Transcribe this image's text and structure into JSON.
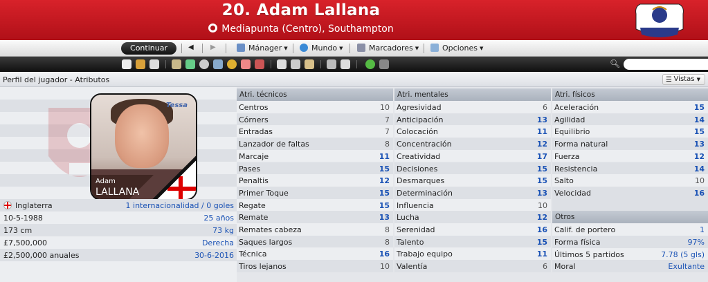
{
  "header": {
    "title": "20. Adam Lallana",
    "subtitle": "Mediapunta (Centro), Southampton"
  },
  "menubar": {
    "continue_label": "Continuar",
    "manager_label": "Mánager",
    "world_label": "Mundo",
    "bookmarks_label": "Marcadores",
    "options_label": "Opciones"
  },
  "panel": {
    "title": "Perfil del jugador - Atributos",
    "views_label": "Vistas"
  },
  "player": {
    "first_name": "Adam",
    "last_name": "LALLANA",
    "nationality": "Inglaterra",
    "caps": "1 internacionalidad / 0 goles",
    "dob": "10-5-1988",
    "age": "25 años",
    "height": "173 cm",
    "weight": "73 kg",
    "value": "£7,500,000",
    "foot": "Derecha",
    "wage": "£2,500,000 anuales",
    "contract_end": "30-6-2016"
  },
  "technical": {
    "header": "Atri. técnicos",
    "rows": [
      {
        "name": "Centros",
        "value": "10",
        "hi": false
      },
      {
        "name": "Córners",
        "value": "7",
        "hi": false
      },
      {
        "name": "Entradas",
        "value": "7",
        "hi": false
      },
      {
        "name": "Lanzador de faltas",
        "value": "8",
        "hi": false
      },
      {
        "name": "Marcaje",
        "value": "11",
        "hi": true
      },
      {
        "name": "Pases",
        "value": "15",
        "hi": true
      },
      {
        "name": "Penaltis",
        "value": "12",
        "hi": true
      },
      {
        "name": "Primer Toque",
        "value": "15",
        "hi": true
      },
      {
        "name": "Regate",
        "value": "15",
        "hi": true
      },
      {
        "name": "Remate",
        "value": "13",
        "hi": true
      },
      {
        "name": "Remates cabeza",
        "value": "8",
        "hi": false
      },
      {
        "name": "Saques largos",
        "value": "8",
        "hi": false
      },
      {
        "name": "Técnica",
        "value": "16",
        "hi": true
      },
      {
        "name": "Tiros lejanos",
        "value": "10",
        "hi": false
      }
    ]
  },
  "mental": {
    "header": "Atri. mentales",
    "rows": [
      {
        "name": "Agresividad",
        "value": "6",
        "hi": false
      },
      {
        "name": "Anticipación",
        "value": "13",
        "hi": true
      },
      {
        "name": "Colocación",
        "value": "11",
        "hi": true
      },
      {
        "name": "Concentración",
        "value": "12",
        "hi": true
      },
      {
        "name": "Creatividad",
        "value": "17",
        "hi": true
      },
      {
        "name": "Decisiones",
        "value": "15",
        "hi": true
      },
      {
        "name": "Desmarques",
        "value": "15",
        "hi": true
      },
      {
        "name": "Determinación",
        "value": "13",
        "hi": true
      },
      {
        "name": "Influencia",
        "value": "10",
        "hi": false
      },
      {
        "name": "Lucha",
        "value": "12",
        "hi": true
      },
      {
        "name": "Serenidad",
        "value": "16",
        "hi": true
      },
      {
        "name": "Talento",
        "value": "15",
        "hi": true
      },
      {
        "name": "Trabajo equipo",
        "value": "11",
        "hi": true
      },
      {
        "name": "Valentía",
        "value": "6",
        "hi": false
      }
    ]
  },
  "physical": {
    "header": "Atri. físicos",
    "rows": [
      {
        "name": "Aceleración",
        "value": "15",
        "hi": true
      },
      {
        "name": "Agilidad",
        "value": "14",
        "hi": true
      },
      {
        "name": "Equilibrio",
        "value": "15",
        "hi": true
      },
      {
        "name": "Forma natural",
        "value": "13",
        "hi": true
      },
      {
        "name": "Fuerza",
        "value": "12",
        "hi": true
      },
      {
        "name": "Resistencia",
        "value": "14",
        "hi": true
      },
      {
        "name": "Salto",
        "value": "10",
        "hi": false
      },
      {
        "name": "Velocidad",
        "value": "16",
        "hi": true
      }
    ]
  },
  "others": {
    "header": "Otros",
    "rows": [
      {
        "name": "Calif. de portero",
        "value": "1",
        "hi": false
      },
      {
        "name": "Forma física",
        "value": "97%",
        "hi": false
      },
      {
        "name": "Últimos 5 partidos",
        "value": "7.78 (5 gls)",
        "hi": false
      },
      {
        "name": "Moral",
        "value": "Exultante",
        "hi": false
      }
    ]
  },
  "colors": {
    "header_red": "#c01820",
    "link_blue": "#1a52b5"
  },
  "icons": [
    "position-icon",
    "premier-league-logo",
    "back-arrow-icon",
    "forward-arrow-icon",
    "manager-icon",
    "world-icon",
    "bookmarks-icon",
    "options-icon",
    "home-icon",
    "search-icon",
    "views-icon",
    "england-flag-icon"
  ]
}
